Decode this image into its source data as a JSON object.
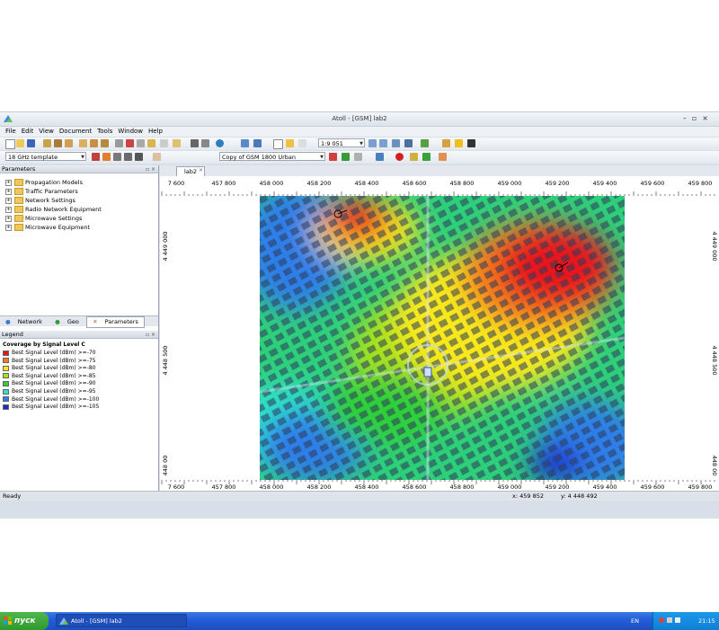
{
  "window": {
    "title": "Atoll - [GSM] lab2"
  },
  "menu": [
    "File",
    "Edit",
    "View",
    "Document",
    "Tools",
    "Window",
    "Help"
  ],
  "toolbar": {
    "scale_value": "1:9 051",
    "template_value": "18 GHz template",
    "propagation_value": "Copy of GSM 1800 Urban"
  },
  "parameters_panel": {
    "title": "Parameters",
    "items": [
      "Propagation Models",
      "Traffic Parameters",
      "Network Settings",
      "Radio Network Equipment",
      "Microwave Settings",
      "Microwave Equipment"
    ],
    "tabs": [
      "Network",
      "Geo",
      "Parameters"
    ]
  },
  "legend_panel": {
    "title": "Legend",
    "heading": "Coverage by Signal Level C",
    "items": [
      {
        "label": "Best Signal Level (dBm) >=-70",
        "color": "#e8141c"
      },
      {
        "label": "Best Signal Level (dBm) >=-75",
        "color": "#f47a1e"
      },
      {
        "label": "Best Signal Level (dBm) >=-80",
        "color": "#f7e81e"
      },
      {
        "label": "Best Signal Level (dBm) >=-85",
        "color": "#a4e21e"
      },
      {
        "label": "Best Signal Level (dBm) >=-90",
        "color": "#2ecf3a"
      },
      {
        "label": "Best Signal Level (dBm) >=-95",
        "color": "#2ee0c8"
      },
      {
        "label": "Best Signal Level (dBm) >=-100",
        "color": "#2e7ee8"
      },
      {
        "label": "Best Signal Level (dBm) >=-105",
        "color": "#1a2ad0"
      }
    ]
  },
  "document": {
    "tab_label": "lab2",
    "x_ticks": [
      "7 600",
      "457 800",
      "458 000",
      "458 200",
      "458 400",
      "458 600",
      "458 800",
      "459 000",
      "459 200",
      "459 400",
      "459 600",
      "459 800"
    ],
    "y_ticks_left": [
      "4 449 000",
      "4 448 500",
      "448 00"
    ],
    "y_ticks_right": [
      "4 449 000",
      "4 448 500",
      "448 00"
    ]
  },
  "status": {
    "ready": "Ready",
    "x_coord": "x: 459 852",
    "y_coord": "y: 4 448 492"
  },
  "taskbar": {
    "start_label": "пуск",
    "task_label": "Atoll - [GSM] lab2",
    "lang": "EN",
    "clock": "21:15"
  }
}
